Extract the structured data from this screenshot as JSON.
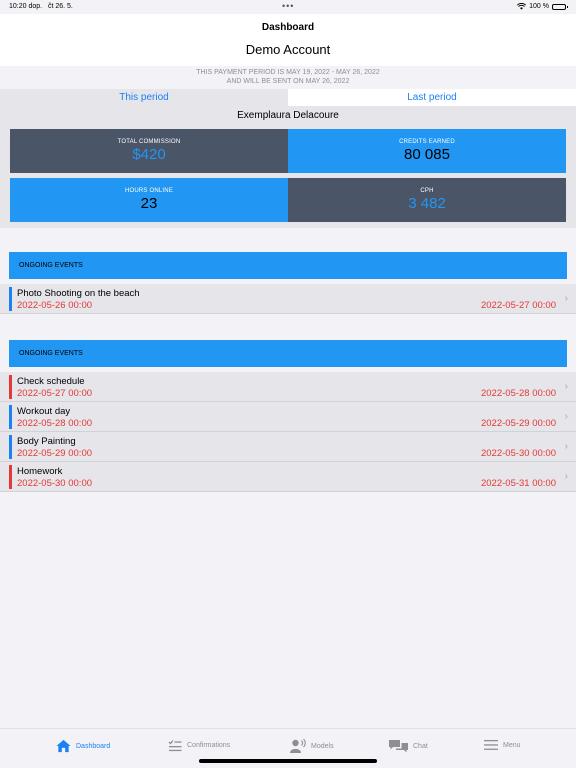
{
  "status": {
    "time": "10:20 dop.",
    "date": "čt 26. 5.",
    "dots": "•••",
    "battery": "100 %"
  },
  "header": {
    "title": "Dashboard",
    "account": "Demo Account"
  },
  "period": {
    "line1": "THIS PAYMENT PERIOD IS MAY 19, 2022 - MAY 26, 2022",
    "line2": "AND WILL BE SENT ON MAY 26, 2022"
  },
  "tabs": [
    {
      "label": "This period"
    },
    {
      "label": "Last period"
    }
  ],
  "model_name": "Exemplaura Delacoure",
  "stats": {
    "total_commission": {
      "label": "TOTAL COMMISSION",
      "value": "$420"
    },
    "credits_earned": {
      "label": "CREDITS EARNED",
      "value": "80 085"
    },
    "hours_online": {
      "label": "HOURS ONLINE",
      "value": "23"
    },
    "cph": {
      "label": "CPH",
      "value": "3 482"
    }
  },
  "sections": [
    {
      "title": "ONGOING EVENTS",
      "events": [
        {
          "name": "Photo Shooting on the beach",
          "start": "2022-05-26 00:00",
          "end": "2022-05-27 00:00",
          "color": "#1a82f5"
        }
      ]
    },
    {
      "title": "ONGOING EVENTS",
      "events": [
        {
          "name": "Check schedule",
          "start": "2022-05-27 00:00",
          "end": "2022-05-28 00:00",
          "color": "#e53935"
        },
        {
          "name": "Workout day",
          "start": "2022-05-28 00:00",
          "end": "2022-05-29 00:00",
          "color": "#1a82f5"
        },
        {
          "name": "Body Painting",
          "start": "2022-05-29 00:00",
          "end": "2022-05-30 00:00",
          "color": "#1a82f5"
        },
        {
          "name": "Homework",
          "start": "2022-05-30 00:00",
          "end": "2022-05-31 00:00",
          "color": "#e53935"
        }
      ]
    }
  ],
  "tabbar": [
    {
      "label": "Dashboard",
      "icon": "home-icon"
    },
    {
      "label": "Confirmations",
      "icon": "checklist-icon"
    },
    {
      "label": "Models",
      "icon": "person-speaking-icon"
    },
    {
      "label": "Chat",
      "icon": "chat-bubbles-icon"
    },
    {
      "label": "Menu",
      "icon": "hamburger-menu-icon"
    }
  ],
  "colors": {
    "accent": "#1a82f5",
    "tile_blue": "#2196f3",
    "tile_dark": "#4a5568",
    "date_red": "#e53935"
  }
}
